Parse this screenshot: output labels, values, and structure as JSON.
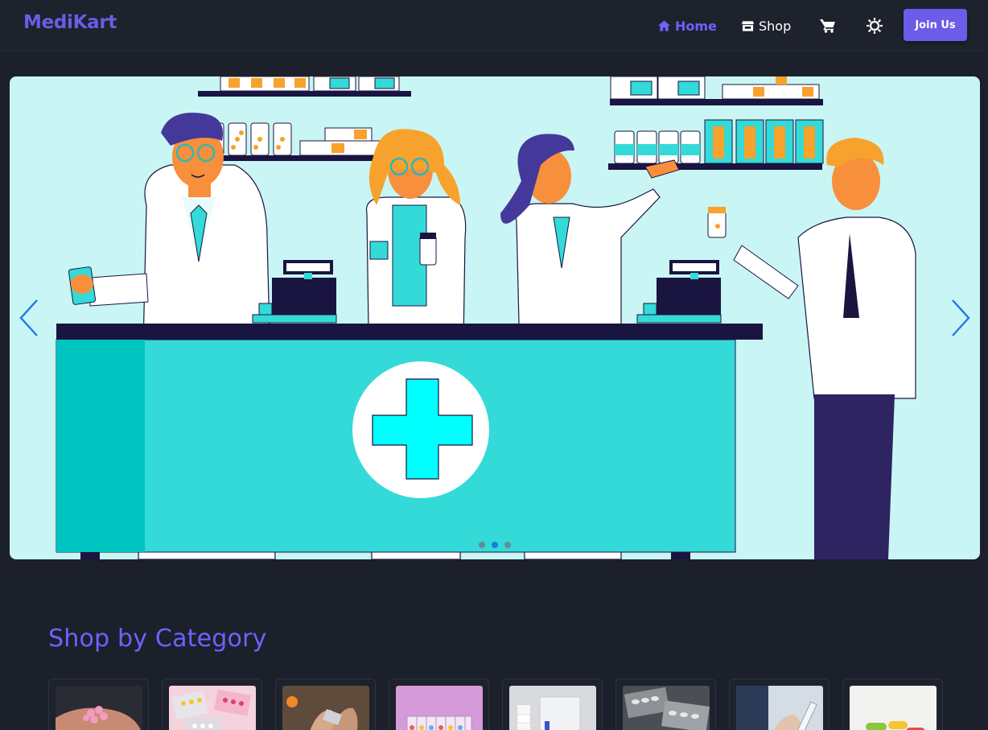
{
  "brand": "MediKart",
  "nav": {
    "home_label": "Home",
    "shop_label": "Shop",
    "join_label": "Join Us"
  },
  "icons": {
    "home": "home-icon",
    "shop": "store-icon",
    "cart": "cart-icon",
    "theme": "sun-icon",
    "prev": "chevron-left-icon",
    "next": "chevron-right-icon"
  },
  "colors": {
    "accent": "#6c5ce7",
    "background": "#1b202b",
    "banner": "#c9f5f5",
    "counter": "#33dad8"
  },
  "carousel": {
    "slide_count": 3,
    "active_index": 1
  },
  "categories": {
    "title": "Shop by Category",
    "items": [
      {
        "image": "pills-in-hand"
      },
      {
        "image": "blister-packs-colorful"
      },
      {
        "image": "hands-opening-pack"
      },
      {
        "image": "pill-organizer"
      },
      {
        "image": "medicine-bottle-box"
      },
      {
        "image": "tablet-strips"
      },
      {
        "image": "hand-holding-syringe"
      },
      {
        "image": "capsules-assorted"
      }
    ]
  }
}
